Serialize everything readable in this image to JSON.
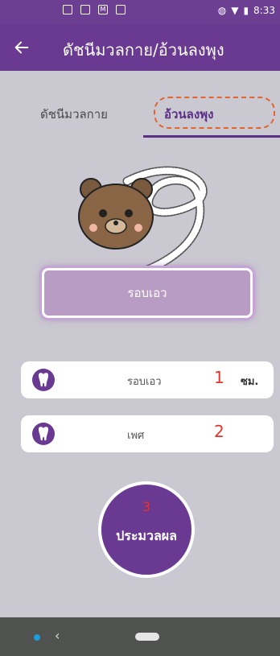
{
  "status_bar": {
    "time": "8:33"
  },
  "app_bar": {
    "title": "ดัชนีมวลกาย/อ้วนลงพุง"
  },
  "tabs": [
    {
      "label": "ดัชนีมวลกาย"
    },
    {
      "label": "อ้วนลงพุง"
    }
  ],
  "waist_button": {
    "label": "รอบเอว"
  },
  "fields": [
    {
      "label": "รอบเอว",
      "number": "1",
      "unit": "ซม."
    },
    {
      "label": "เพศ",
      "number": "2"
    }
  ],
  "calc_button": {
    "number": "3",
    "label": "ประมวลผล"
  },
  "colors": {
    "primary": "#6a3991",
    "highlight": "#e3642f",
    "annotation": "#e4332a"
  }
}
